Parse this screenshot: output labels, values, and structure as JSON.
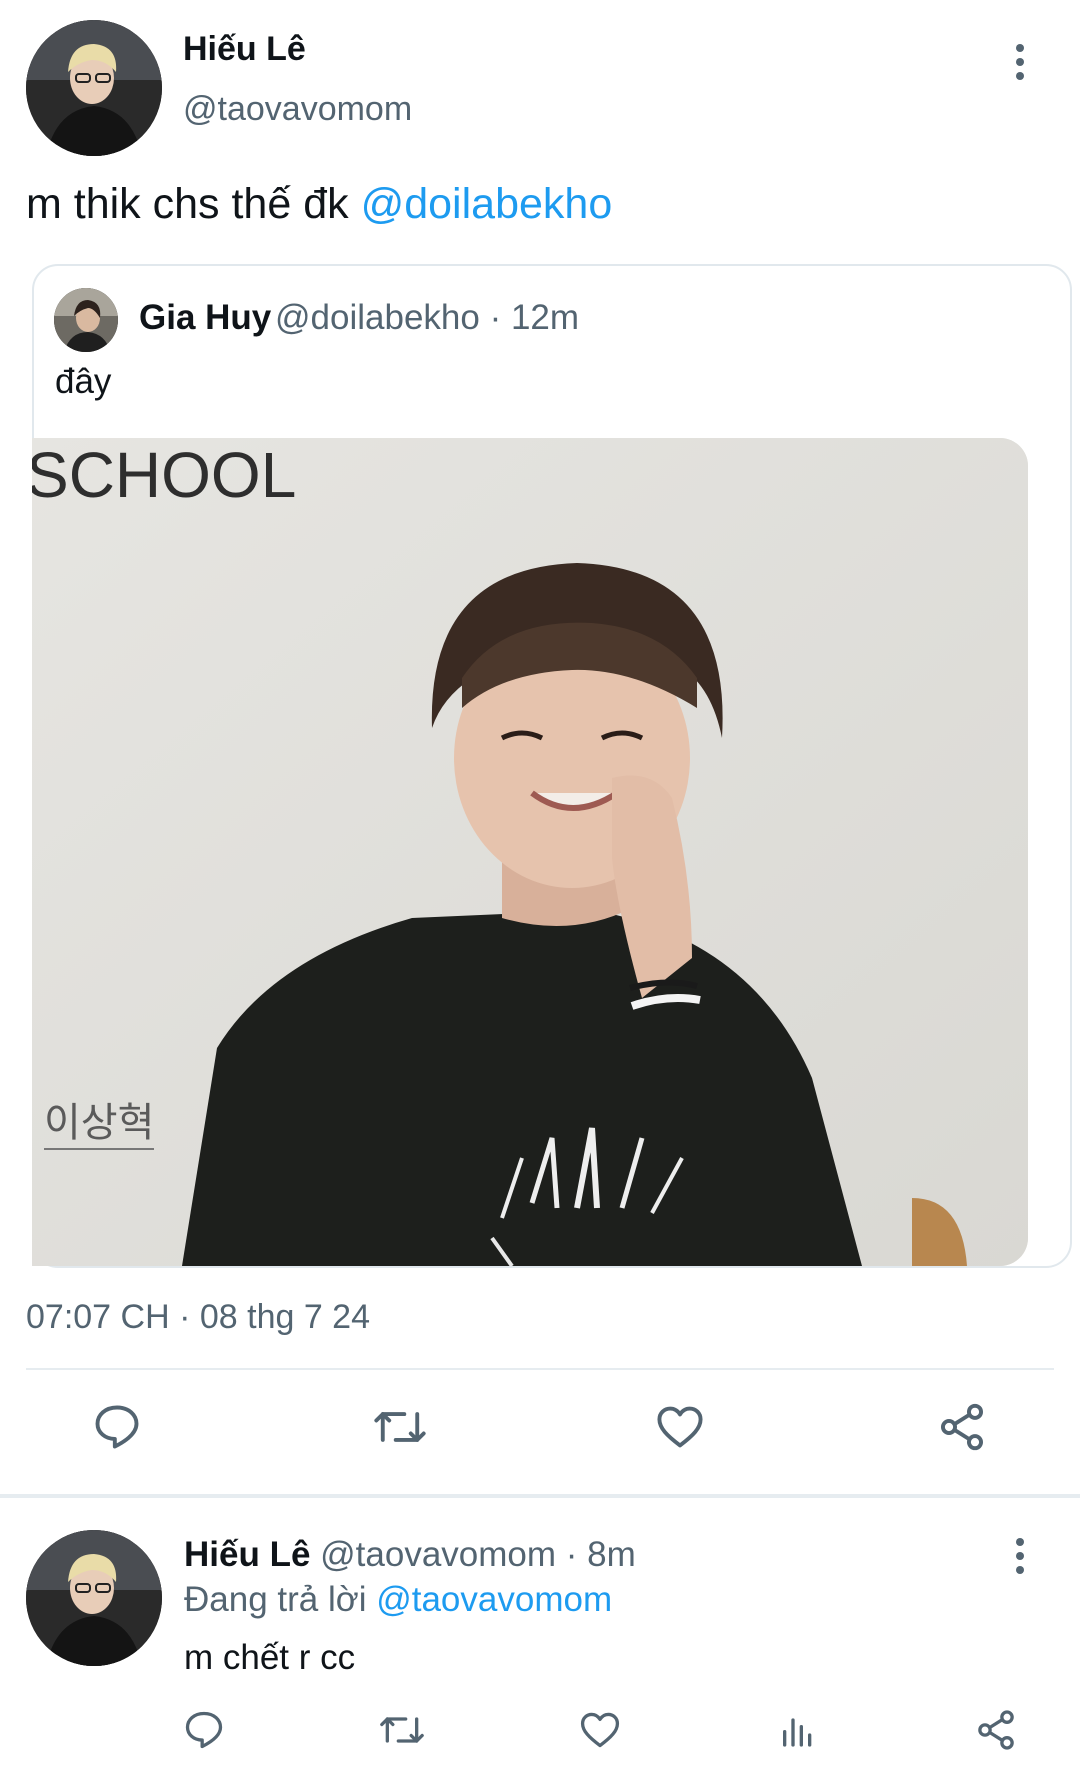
{
  "main_tweet": {
    "author_name": "Hiếu Lê",
    "author_handle": "@taovavomom",
    "text_prefix": "m thik chs thế đk ",
    "text_mention": "@doilabekho",
    "timestamp": "07:07 CH · 08 thg 7 24"
  },
  "quoted_tweet": {
    "author_name": "Gia Huy",
    "meta": "@doilabekho · 12m",
    "text": "đây",
    "photo": {
      "heading_text": "SCHOOL",
      "caption_text": "이상혁"
    }
  },
  "reply_tweet": {
    "author_name": "Hiếu Lê",
    "meta": "@taovavomom · 8m",
    "replying_prefix": "Đang trả lời ",
    "replying_to": "@taovavomom",
    "text": "m chết r cc"
  },
  "icons": {
    "reply": "reply-icon",
    "retweet": "retweet-icon",
    "like": "heart-icon",
    "share": "share-icon",
    "analytics": "analytics-icon",
    "more": "more-vertical-icon"
  },
  "colors": {
    "link": "#1d9bf0",
    "secondary_text": "#536471",
    "primary_text": "#0f1419",
    "divider": "#e6ecf0"
  }
}
